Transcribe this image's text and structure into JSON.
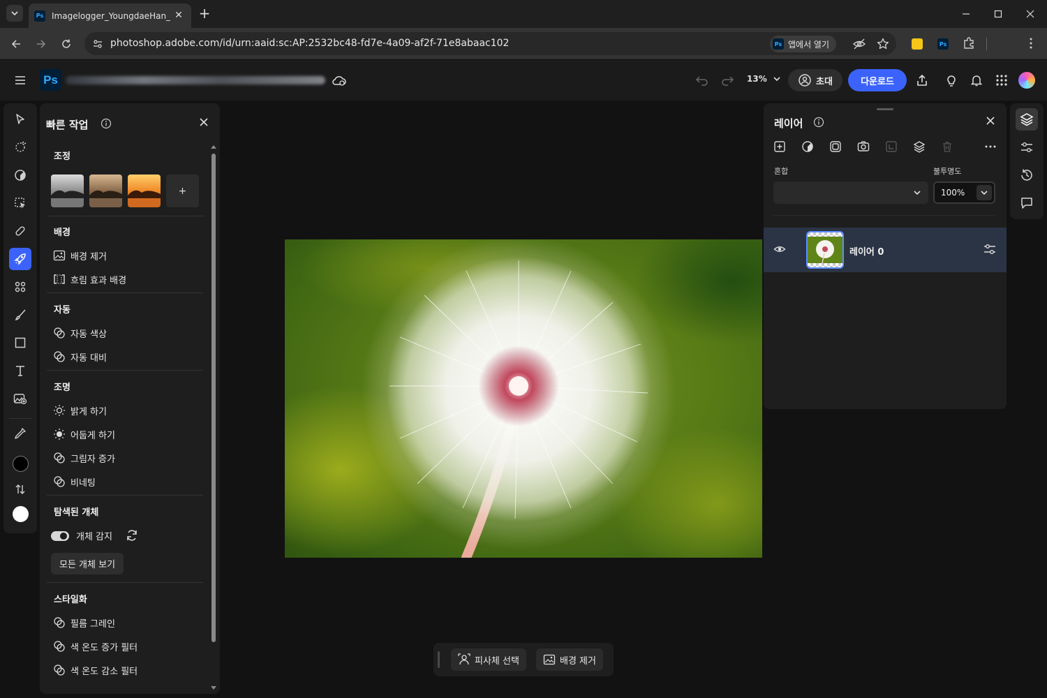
{
  "browser": {
    "tab_title": "Imagelogger_YoungdaeHan_N",
    "url": "photoshop.adobe.com/id/urn:aaid:sc:AP:2532bc48-fd7e-4a09-af2f-71e8abaac102",
    "open_in_app": "앱에서 열기",
    "favicon_text": "Ps"
  },
  "app": {
    "logo": "Ps",
    "zoom": "13%",
    "invite_label": "초대",
    "download_label": "다운로드",
    "accent_color": "#3b63fb"
  },
  "quick_actions": {
    "title": "빠른 작업",
    "sections": {
      "adjust": {
        "heading": "조정",
        "add_symbol": "+"
      },
      "background": {
        "heading": "배경",
        "items": [
          "배경 제거",
          "흐림 효과 배경"
        ]
      },
      "auto": {
        "heading": "자동",
        "items": [
          "자동 색상",
          "자동 대비"
        ]
      },
      "lighting": {
        "heading": "조명",
        "items": [
          "밝게 하기",
          "어둡게 하기",
          "그림자 증가",
          "비네팅"
        ]
      },
      "detected": {
        "heading": "탐색된 개체",
        "toggle_label": "개체 감지",
        "view_all": "모든 개체 보기"
      },
      "stylize": {
        "heading": "스타일화",
        "items": [
          "필름 그레인",
          "색 온도 증가 필터",
          "색 온도 감소 필터"
        ]
      }
    }
  },
  "context_bar": {
    "select_subject": "피사체 선택",
    "remove_background": "배경 제거"
  },
  "layers": {
    "title": "레이어",
    "blend_label": "혼합",
    "opacity_label": "불투명도",
    "opacity_value": "100%",
    "layer_name": "레이어 0"
  }
}
